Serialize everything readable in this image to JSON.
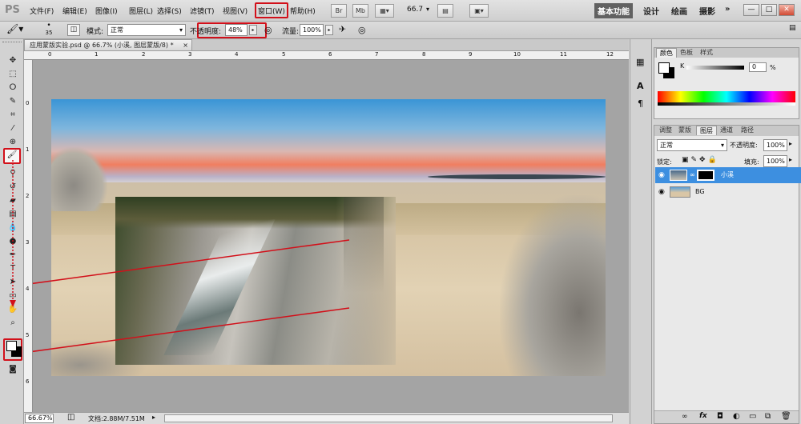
{
  "app": {
    "logo": "PS"
  },
  "menu": [
    "文件(F)",
    "编辑(E)",
    "图像(I)",
    "图层(L)",
    "选择(S)",
    "滤镜(T)",
    "视图(V)",
    "窗口(W)",
    "帮助(H)"
  ],
  "appbar": {
    "br": "Br",
    "mb": "Mb",
    "zoom": "66.7"
  },
  "workspaces": [
    "基本功能",
    "设计",
    "绘画",
    "摄影",
    "»"
  ],
  "window_buttons": [
    "—",
    "□",
    "✕"
  ],
  "options": {
    "brush_size": "35",
    "mode_label": "模式:",
    "mode_value": "正常",
    "opacity_label": "不透明度:",
    "opacity_value": "48%",
    "flow_label": "流量:",
    "flow_value": "100%"
  },
  "document": {
    "tab_title": "应用蒙版实验.psd @ 66.7% (小溪, 图层蒙版/8) *",
    "tab_close": "×",
    "ruler_top": [
      "0",
      "1",
      "2",
      "3",
      "4",
      "5",
      "6",
      "7",
      "8",
      "9",
      "10",
      "11",
      "12"
    ],
    "ruler_left": [
      "0",
      "1",
      "2",
      "3",
      "4",
      "5",
      "6"
    ]
  },
  "status": {
    "zoom": "66.67%",
    "doc_info": "文档:2.88M/7.51M"
  },
  "color_panel": {
    "tabs": [
      "颜色",
      "色板",
      "样式"
    ],
    "k_label": "K",
    "k_value": "0",
    "k_unit": "%"
  },
  "layers_panel": {
    "tabs": [
      "调整",
      "蒙版",
      "图层",
      "通道",
      "路径"
    ],
    "blend_mode": "正常",
    "opacity_label": "不透明度:",
    "opacity_value": "100%",
    "lock_label": "锁定:",
    "fill_label": "填充:",
    "fill_value": "100%",
    "layers": [
      {
        "name": "小溪",
        "selected": true
      },
      {
        "name": "BG",
        "selected": false
      }
    ],
    "footer_icons": [
      "link-icon",
      "fx-icon",
      "mask-icon",
      "adjust-icon",
      "folder-icon",
      "new-layer-icon",
      "trash-icon"
    ]
  },
  "colors": {
    "accent": "#3d8fe0",
    "highlight_red": "#d2101a"
  }
}
